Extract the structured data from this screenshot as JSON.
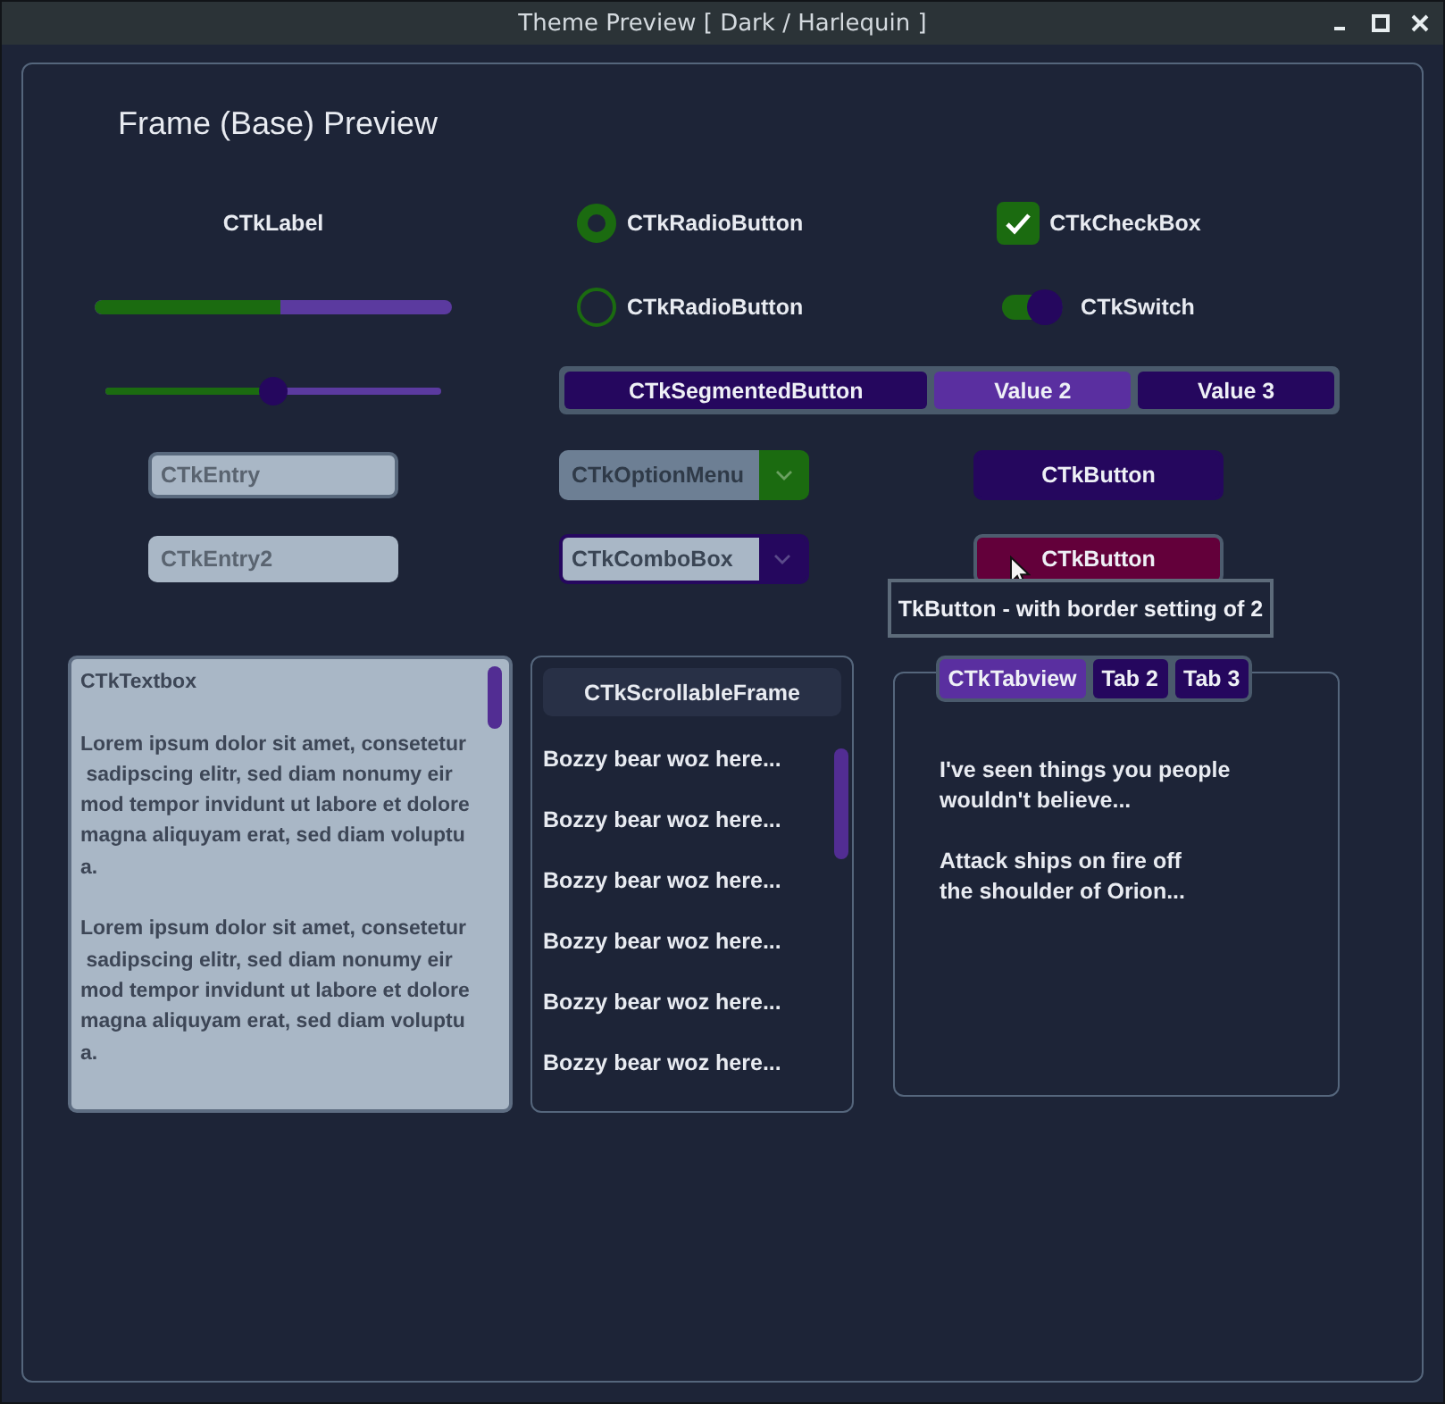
{
  "window": {
    "title": "Theme Preview [ Dark / Harlequin ]"
  },
  "frame": {
    "title": "Frame (Base) Preview"
  },
  "label": {
    "text": "CTkLabel"
  },
  "radio_buttons": [
    {
      "label": "CTkRadioButton",
      "selected": true
    },
    {
      "label": "CTkRadioButton",
      "selected": false
    }
  ],
  "checkbox": {
    "label": "CTkCheckBox",
    "checked": true
  },
  "progress_bar": {
    "level": 0.52
  },
  "switch": {
    "label": "CTkSwitch",
    "on": true
  },
  "slider": {
    "level": 0.5
  },
  "segmented_button": {
    "segments": [
      {
        "label": "CTkSegmentedButton",
        "selected": false
      },
      {
        "label": "Value 2",
        "selected": true
      },
      {
        "label": "Value 3",
        "selected": false
      }
    ]
  },
  "entries": [
    {
      "placeholder": "CTkEntry",
      "focused": true
    },
    {
      "placeholder": "CTkEntry2",
      "focused": false
    }
  ],
  "option_menu": {
    "value": "CTkOptionMenu"
  },
  "combo_box": {
    "value": "CTkComboBox"
  },
  "buttons": [
    {
      "label": "CTkButton",
      "hovered": false
    },
    {
      "label": "CTkButton",
      "hovered": true
    }
  ],
  "tooltip": {
    "text": "TkButton - with border setting of 2"
  },
  "textbox": {
    "text": "CTkTextbox\n\nLorem ipsum dolor sit amet, consetetur\n sadipscing elitr, sed diam nonumy eir\nmod tempor invidunt ut labore et dolore\nmagna aliquyam erat, sed diam voluptu\na.\n\nLorem ipsum dolor sit amet, consetetur\n sadipscing elitr, sed diam nonumy eir\nmod tempor invidunt ut labore et dolore\nmagna aliquyam erat, sed diam voluptu\na."
  },
  "scrollable_frame": {
    "title": "CTkScrollableFrame",
    "items": [
      "Bozzy bear woz here...",
      "Bozzy bear woz here...",
      "Bozzy bear woz here...",
      "Bozzy bear woz here...",
      "Bozzy bear woz here...",
      "Bozzy bear woz here..."
    ]
  },
  "tabview": {
    "tabs": [
      {
        "label": "CTkTabview",
        "selected": true
      },
      {
        "label": "Tab 2",
        "selected": false
      },
      {
        "label": "Tab 3",
        "selected": false
      }
    ],
    "content": "I've seen things you people\nwouldn't believe...\n\nAttack ships on fire off\nthe shoulder of Orion..."
  }
}
